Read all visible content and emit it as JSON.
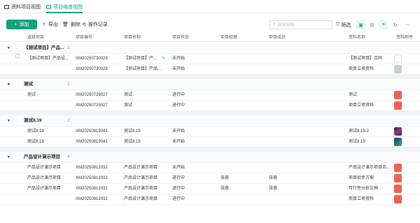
{
  "tabs": [
    {
      "label": "资料项目视图"
    },
    {
      "label": "项目维度视图"
    }
  ],
  "toolbar": {
    "add": "添加",
    "export": "导出",
    "delete": "删除",
    "log": "操作记录",
    "search_placeholder": "搜索数据",
    "filter": "筛选"
  },
  "columns": [
    "选择项目",
    "项目编号",
    "项目名称",
    "项目状态",
    "项目经理",
    "项目成员",
    "资料名称",
    "资料附件"
  ],
  "groups": [
    {
      "name": "【测试项目】产品...",
      "count": "2",
      "rows": [
        {
          "sel": "【测试项目】产品设...",
          "code": "XM20250730029",
          "name": "【测试项目】产...",
          "status": "未开始",
          "manager": "",
          "member": "",
          "doc": "【测试项目】合同",
          "att": "doc"
        },
        {
          "sel": "",
          "code": "XM20250730028",
          "name": "【测试项目】产品...",
          "status": "未开始",
          "manager": "",
          "member": "",
          "doc": "项目立项资料",
          "att": "img"
        }
      ]
    },
    {
      "name": "测试",
      "count": "2",
      "rows": [
        {
          "sel": "测试",
          "code": "XM20250729027",
          "name": "测试",
          "status": "进行中",
          "manager": "",
          "member": "",
          "doc": "测试",
          "att": "pdf"
        },
        {
          "sel": "",
          "code": "XM20250729027",
          "name": "测试",
          "status": "进行中",
          "manager": "",
          "member": "",
          "doc": "项目立项资料",
          "att": "pdf"
        }
      ]
    },
    {
      "name": "测试8.19",
      "count": "2",
      "rows": [
        {
          "sel": "测试8.19",
          "code": "XM20250819041",
          "name": "测试8.19",
          "status": "未开始",
          "manager": "",
          "member": "",
          "doc": "测试8.19-2",
          "att": "dark"
        },
        {
          "sel": "测试8.19",
          "code": "XM20250819041",
          "name": "测试8.19",
          "status": "未开始",
          "manager": "",
          "member": "",
          "doc": "测试8.19",
          "att": "teal"
        }
      ]
    },
    {
      "name": "产品设计演示项目",
      "count": "4",
      "rows": [
        {
          "sel": "产品设计演示项目",
          "code": "XM20250812032",
          "name": "产品设计演示项目",
          "status": "未开始",
          "manager": "",
          "member": "",
          "doc": "产品设计演示项目合...",
          "att": "pdf"
        },
        {
          "sel": "产品设计演示项目",
          "code": "XM20250812032",
          "name": "产品设计演示项目",
          "status": "进行中",
          "manager": "张睿",
          "member": "张睿",
          "doc": "项目初步方案",
          "att": "pdf"
        },
        {
          "sel": "产品设计演示项目",
          "code": "XM20250812032",
          "name": "产品设计演示项目",
          "status": "进行中",
          "manager": "张睿",
          "member": "张睿",
          "doc": "可行性分析文档",
          "att": "pdf"
        },
        {
          "sel": "",
          "code": "XM20250812032",
          "name": "产品设计演示项目",
          "status": "进行中",
          "manager": "",
          "member": "",
          "doc": "项目立项资料",
          "att": "pdf"
        }
      ]
    }
  ],
  "colors": {
    "accent": "#14a07c",
    "pdf": "#f0614f"
  }
}
